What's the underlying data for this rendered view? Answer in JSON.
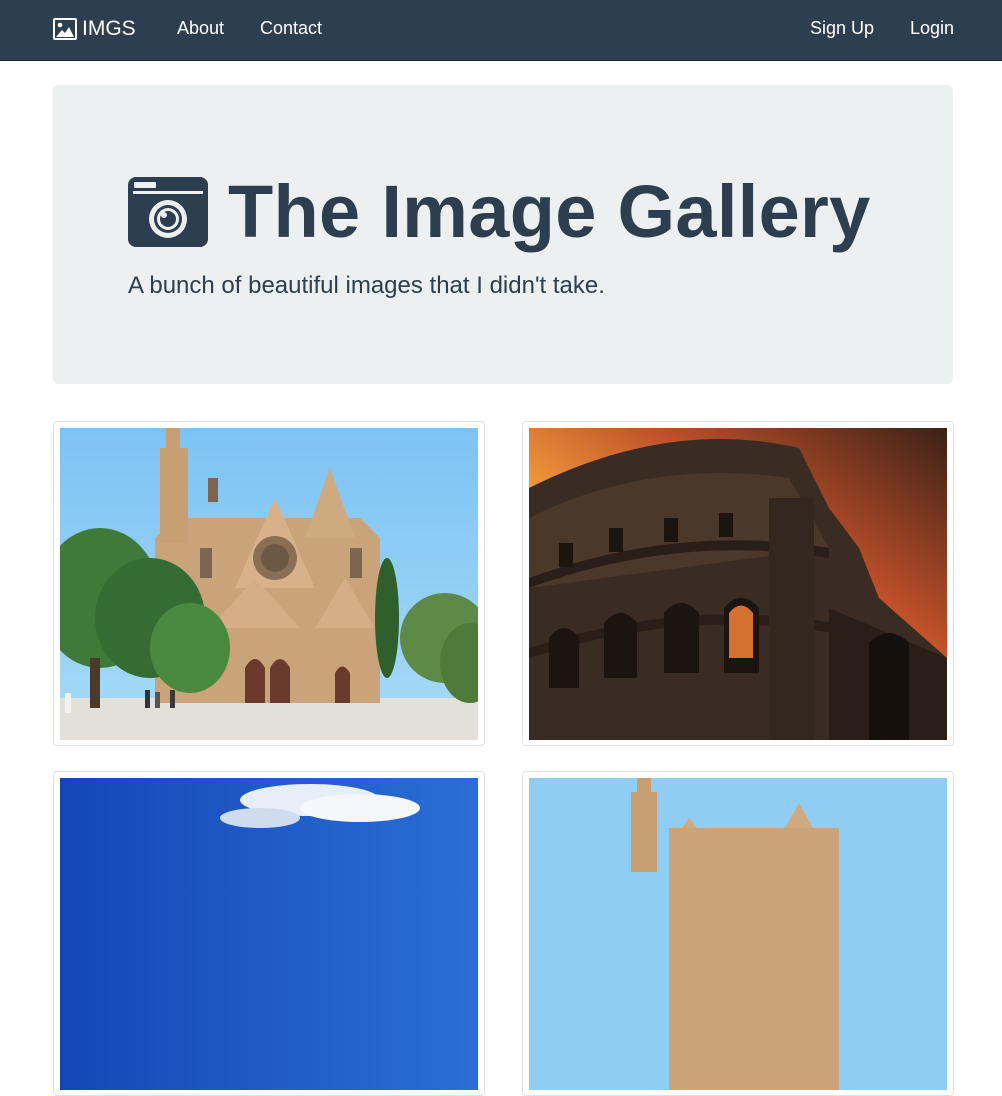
{
  "navbar": {
    "brand": "IMGS",
    "links": [
      {
        "label": "About"
      },
      {
        "label": "Contact"
      }
    ],
    "auth": {
      "signup": "Sign Up",
      "login": "Login"
    },
    "background": "#2c3e50"
  },
  "jumbotron": {
    "title": "The Image Gallery",
    "subtitle": "A bunch of beautiful images that I didn't take.",
    "icon": "camera-icon",
    "background": "#ecf0f1"
  },
  "gallery": {
    "images": [
      {
        "subject": "cathedral-photo"
      },
      {
        "subject": "colosseum-photo"
      },
      {
        "subject": "sky-clouds-photo"
      },
      {
        "subject": "cathedral-photo"
      }
    ]
  },
  "colors": {
    "primary": "#2c3e50",
    "light": "#ecf0f1"
  }
}
